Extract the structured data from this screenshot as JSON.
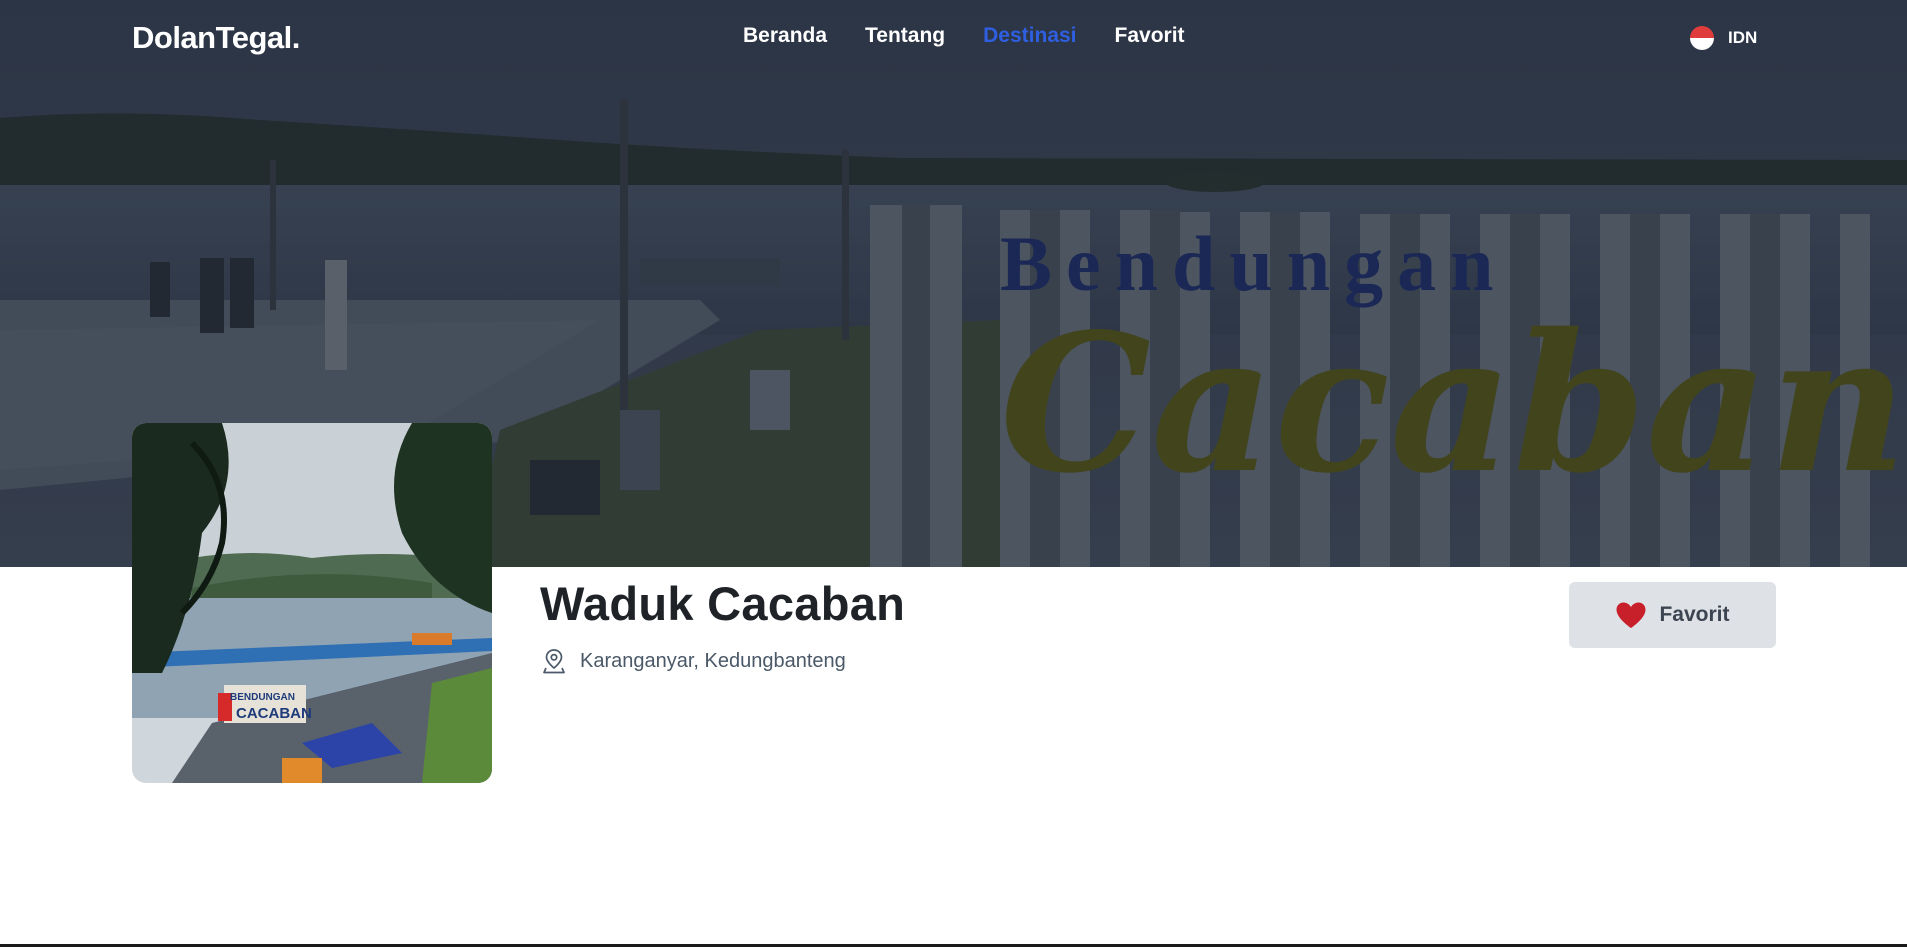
{
  "navbar": {
    "logo": "DolanTegal.",
    "links": [
      {
        "label": "Beranda",
        "active": false
      },
      {
        "label": "Tentang",
        "active": false
      },
      {
        "label": "Destinasi",
        "active": true
      },
      {
        "label": "Favorit",
        "active": false
      }
    ],
    "language": {
      "label": "IDN",
      "icon": "indonesia-flag-icon"
    }
  },
  "hero": {
    "sign_text_top": "Bendungan",
    "sign_text_main": "Cacaban"
  },
  "destination": {
    "title": "Waduk Cacaban",
    "location": "Karanganyar, Kedungbanteng",
    "location_icon": "map-pin-icon",
    "thumbnail_sign": [
      "BENDUNGAN",
      "CACABAN"
    ]
  },
  "actions": {
    "favorite_label": "Favorit",
    "favorite_icon": "heart-icon"
  },
  "colors": {
    "accent": "#2f5fe0",
    "heart": "#c8202a",
    "title": "#1f2328",
    "button_bg": "#dee1e5"
  }
}
